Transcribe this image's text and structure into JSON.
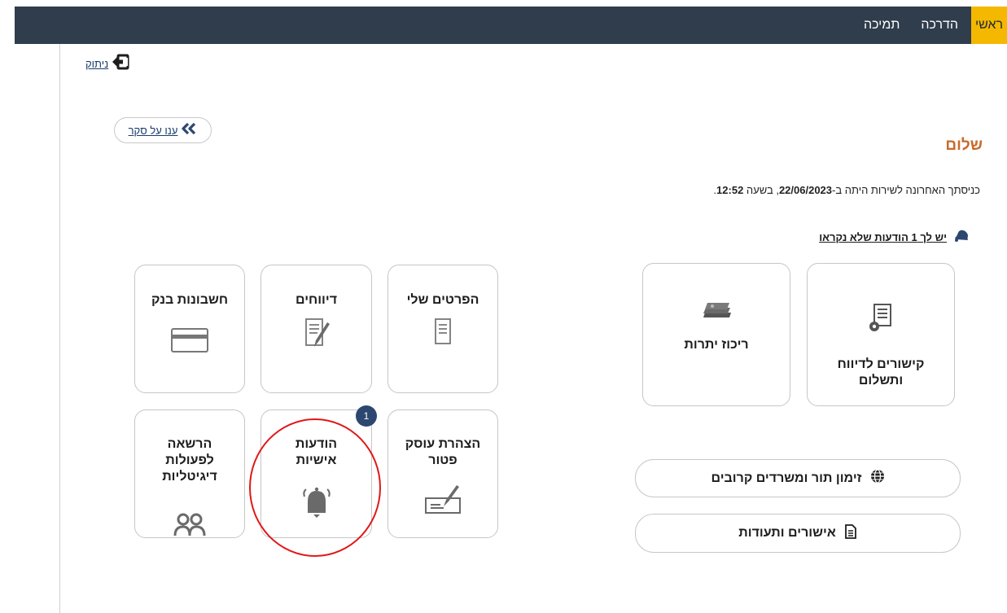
{
  "topnav": {
    "items": [
      {
        "label": "ראשי",
        "active": true
      },
      {
        "label": "הדרכה",
        "active": false
      },
      {
        "label": "תמיכה",
        "active": false
      }
    ]
  },
  "logout": {
    "label": "ניתוק",
    "icon": "logout-icon"
  },
  "survey": {
    "label": "ענו על סקר",
    "icon": "double-chevron-left-icon"
  },
  "greeting": "שלום",
  "last_visit": {
    "prefix": "כניסתך האחרונה לשירות היתה ב-",
    "date": "22/06/2023",
    "middle": ", בשעה ",
    "time": "12:52",
    "suffix": "."
  },
  "notifications_link": {
    "label": "יש לך 1 הודעות שלא נקראו",
    "icon": "bell-icon"
  },
  "tiles": {
    "payment_links": {
      "title_line1": "קישורים לדיווח",
      "title_line2": "ותשלום",
      "icon": "document-gear-icon"
    },
    "balances": {
      "title": "ריכוז יתרות",
      "icon": "money-stack-icon"
    },
    "my_details": {
      "title": "הפרטים שלי",
      "icon": "document-list-icon"
    },
    "reports": {
      "title": "דיווחים",
      "icon": "document-edit-icon"
    },
    "bank_accounts": {
      "title": "חשבונות בנק",
      "icon": "credit-card-icon"
    },
    "exempt_dealer": {
      "title_line1": "הצהרת עוסק",
      "title_line2": "פטור",
      "icon": "check-sign-icon"
    },
    "personal_messages": {
      "title_line1": "הודעות",
      "title_line2": "אישיות",
      "icon": "bell-icon",
      "badge": "1"
    },
    "digital_authorization": {
      "title_line1": "הרשאה",
      "title_line2": "לפעולות",
      "title_line3": "דיגיטליות",
      "icon": "people-icon"
    }
  },
  "pills": [
    {
      "label": "זימון תור ומשרדים קרובים",
      "icon": "globe-icon"
    },
    {
      "label": "אישורים ותעודות",
      "icon": "document-icon"
    }
  ],
  "colors": {
    "topbar": "#2f3d4c",
    "active_nav": "#f5b800",
    "greeting": "#c86a2a",
    "badge": "#2c4770",
    "highlight_circle": "#e01818"
  }
}
